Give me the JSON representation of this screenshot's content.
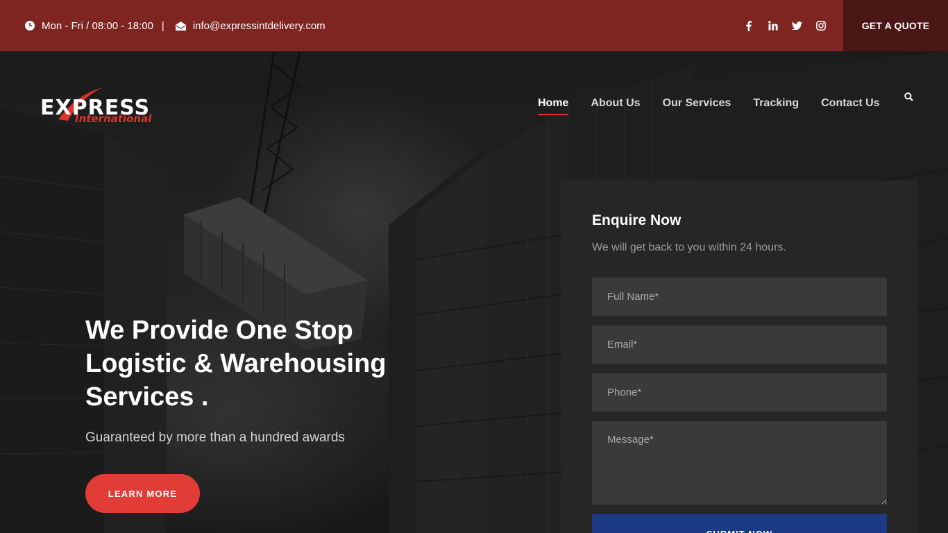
{
  "topbar": {
    "hours": "Mon - Fri / 08:00 - 18:00",
    "separator": "|",
    "email": "info@expressintdelivery.com",
    "socials": [
      "facebook-icon",
      "linkedin-icon",
      "twitter-icon",
      "instagram-icon"
    ],
    "quote_label": "GET A QUOTE"
  },
  "logo": {
    "word": "EXPRESS",
    "sub": "International"
  },
  "nav": {
    "items": [
      "Home",
      "About Us",
      "Our Services",
      "Tracking",
      "Contact Us"
    ],
    "active": "Home"
  },
  "hero": {
    "headline": "We Provide One Stop Logistic & Warehousing Services .",
    "subline": "Guaranteed by more than a hundred awards",
    "cta_label": "LEARN MORE"
  },
  "form": {
    "title": "Enquire Now",
    "description": "We will get back to you within 24 hours.",
    "name_placeholder": "Full Name*",
    "email_placeholder": "Email*",
    "phone_placeholder": "Phone*",
    "message_placeholder": "Message*",
    "submit_label": "SUBMIT NOW"
  },
  "colors": {
    "topbar_bg": "#7e2522",
    "quote_bg": "#4b1716",
    "accent_red": "#e23c36",
    "submit_blue": "#1c3a86"
  }
}
